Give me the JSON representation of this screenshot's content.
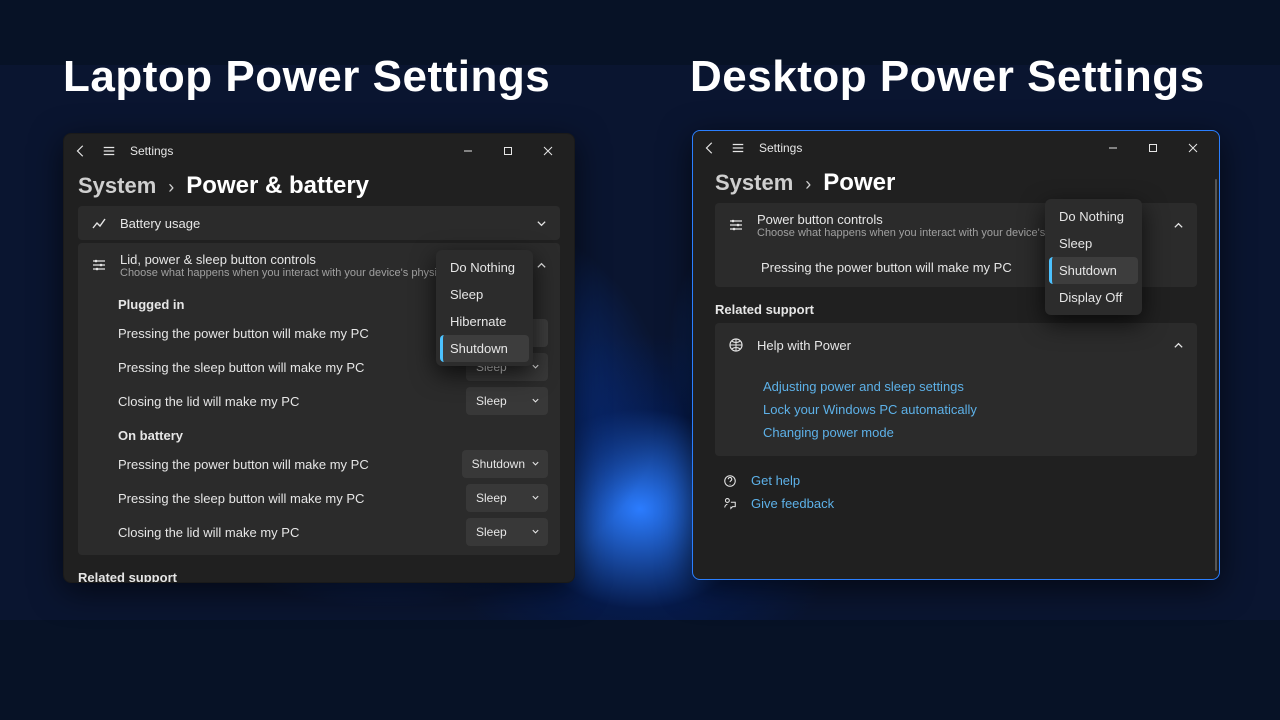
{
  "headings": {
    "left": "Laptop Power Settings",
    "right": "Desktop Power Settings"
  },
  "common": {
    "settings_title": "Settings",
    "breadcrumb_root": "System",
    "related_support": "Related support"
  },
  "menu_options": {
    "do_nothing": "Do Nothing",
    "sleep": "Sleep",
    "hibernate": "Hibernate",
    "shutdown": "Shutdown",
    "display_off": "Display Off"
  },
  "laptop": {
    "page_title": "Power & battery",
    "battery_usage": "Battery usage",
    "lid_controls_title": "Lid, power & sleep button controls",
    "lid_controls_sub": "Choose what happens when you interact with your device's physical controls",
    "plugged_in": "Plugged in",
    "on_battery": "On battery",
    "power_button_label": "Pressing the power button will make my PC",
    "sleep_button_label": "Pressing the sleep button will make my PC",
    "close_lid_label": "Closing the lid will make my PC",
    "values": {
      "plugged_power": "Shutdown",
      "plugged_sleep": "Sleep",
      "plugged_lid": "Sleep",
      "battery_power": "Shutdown",
      "battery_sleep": "Sleep",
      "battery_lid": "Sleep"
    }
  },
  "desktop": {
    "page_title": "Power",
    "pbc_title": "Power button controls",
    "pbc_sub": "Choose what happens when you interact with your device's physical cont",
    "power_button_label": "Pressing the power button will make my PC",
    "help_with_power": "Help with Power",
    "links": {
      "adjusting": "Adjusting power and sleep settings",
      "lock": "Lock your Windows PC automatically",
      "mode": "Changing power mode"
    },
    "get_help": "Get help",
    "give_feedback": "Give feedback"
  }
}
